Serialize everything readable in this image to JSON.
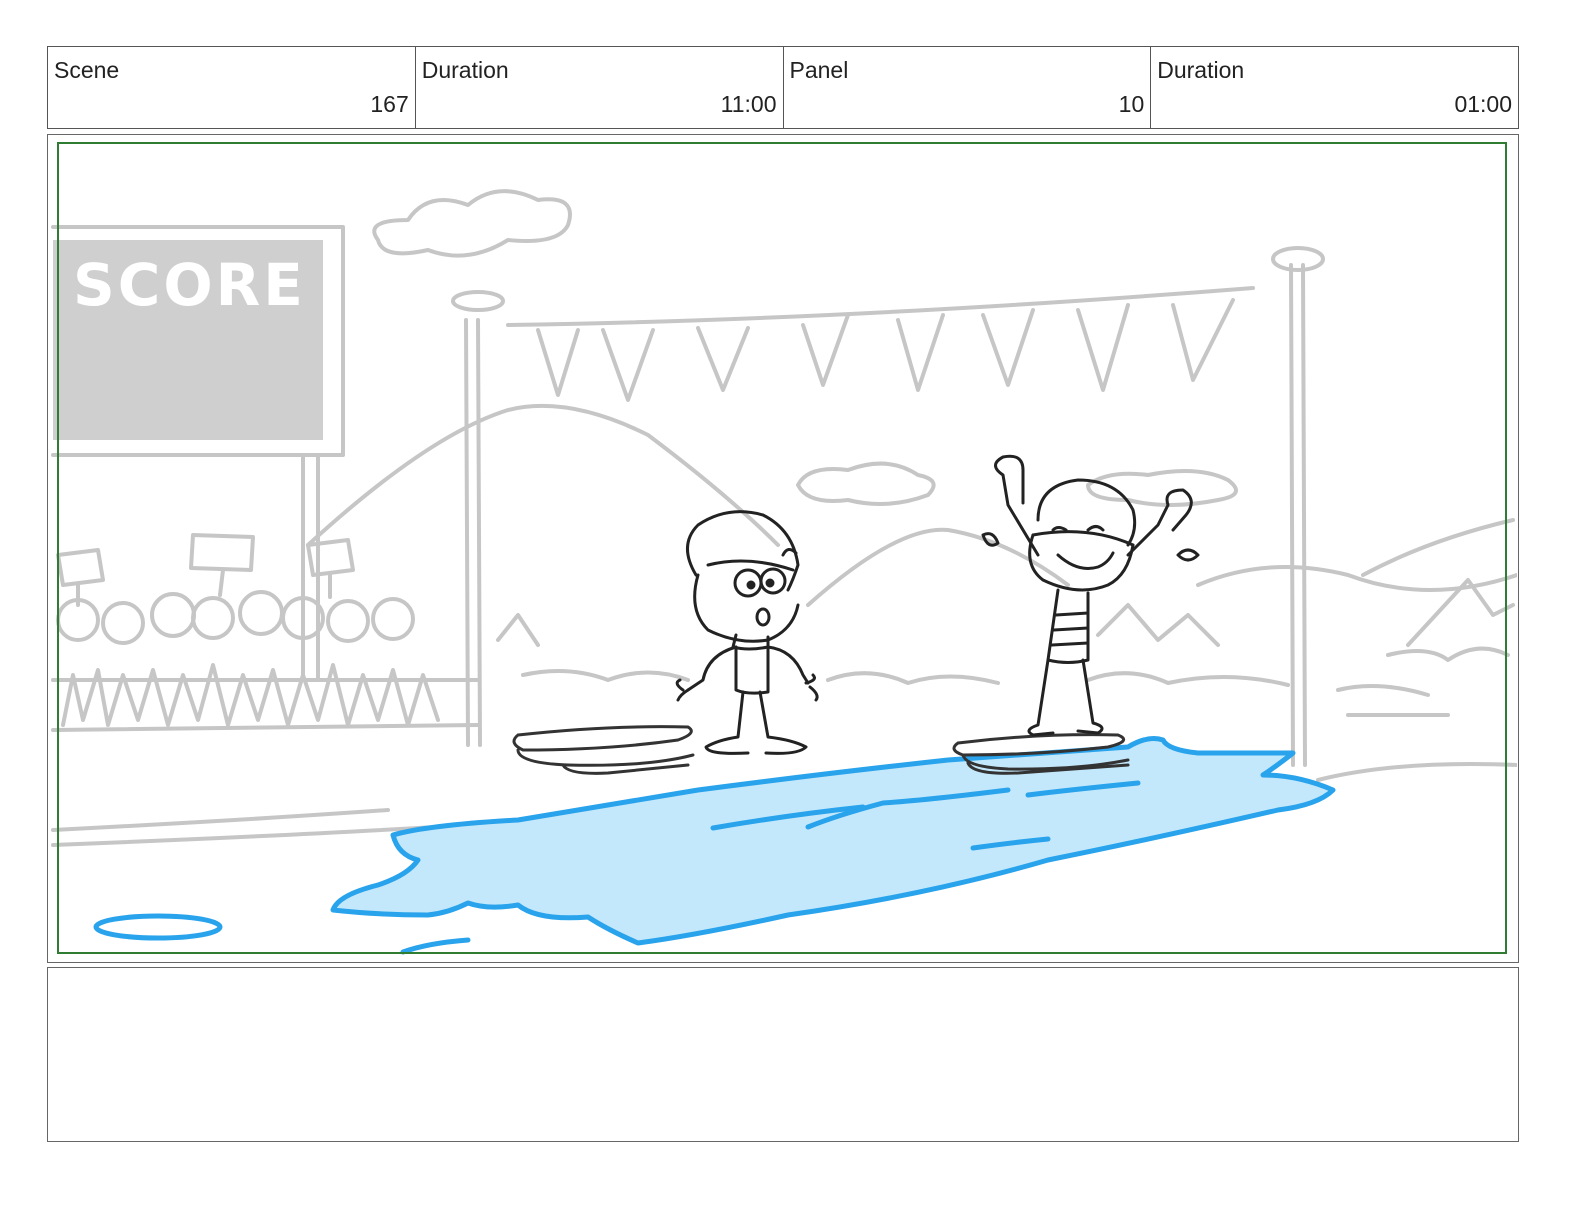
{
  "header": {
    "scene_label": "Scene",
    "scene_value": "167",
    "scene_duration_label": "Duration",
    "scene_duration_value": "11:00",
    "panel_label": "Panel",
    "panel_value": "10",
    "panel_duration_label": "Duration",
    "panel_duration_value": "01:00"
  },
  "panel": {
    "scoreboard_text": "SCORE",
    "safe_area_color": "#2e7d32",
    "puddle_fill": "#c4e8fb",
    "puddle_stroke": "#29a3ec",
    "sketch_gray": "#c6c6c6"
  },
  "notes": {
    "text": ""
  }
}
